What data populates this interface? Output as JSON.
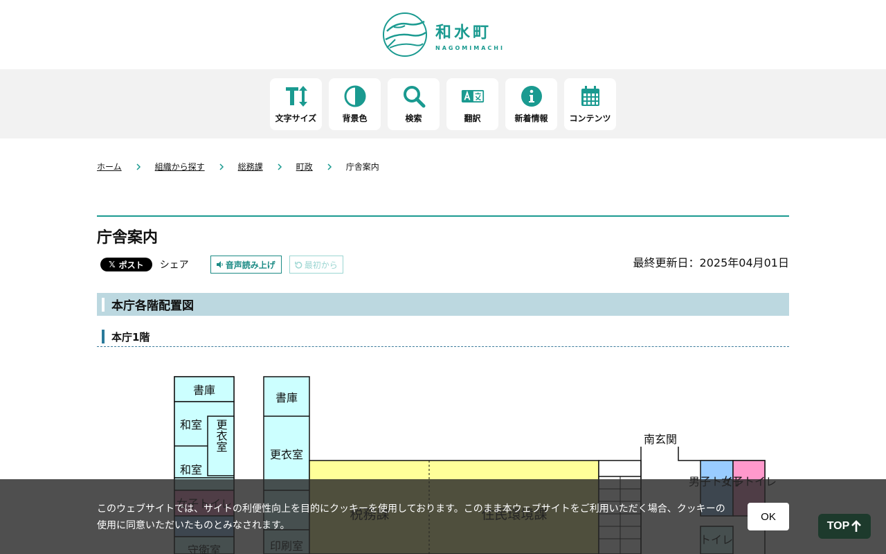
{
  "site": {
    "logo_title": "和水町",
    "logo_sub": "NAGOMIMACHI",
    "accent": "#1a9a90"
  },
  "toolbar": [
    {
      "label": "文字サイズ",
      "icon": "text-size-icon"
    },
    {
      "label": "背景色",
      "icon": "contrast-icon"
    },
    {
      "label": "検索",
      "icon": "search-icon"
    },
    {
      "label": "翻訳",
      "icon": "translate-icon"
    },
    {
      "label": "新着情報",
      "icon": "info-icon"
    },
    {
      "label": "コンテンツ",
      "icon": "calendar-icon"
    }
  ],
  "breadcrumb": [
    "ホーム",
    "組織から探す",
    "総務課",
    "町政",
    "庁舎案内"
  ],
  "page": {
    "title": "庁舎案内",
    "share_post": "ポスト",
    "share_label": "シェア",
    "tts_label": "音声読み上げ",
    "restart_label": "最初から",
    "updated": "最終更新日：2025年04月01日",
    "h2": "本庁各階配置図",
    "h3": "本庁1階"
  },
  "floorplan": {
    "rooms": [
      "書庫",
      "和室",
      "更衣室",
      "和室",
      "書庫",
      "更衣室",
      "女子トイレ",
      "守衛室",
      "印刷室",
      "税務課",
      "住民環境課",
      "南玄関",
      "男子トイレ",
      "女子トイレ",
      "トイレ"
    ],
    "colors": {
      "office": "#ffff99",
      "storage": "#ccffff",
      "mens_toilet": "#99ccff",
      "womens_toilet": "#ff99cc"
    }
  },
  "cookie": {
    "text": "このウェブサイトでは、サイトの利便性向上を目的にクッキーを使用しております。このまま本ウェブサイトをご利用いただく場合、クッキーの使用に同意いただいたものとみなされます。",
    "ok_label": "OK"
  },
  "top_button": "TOP"
}
